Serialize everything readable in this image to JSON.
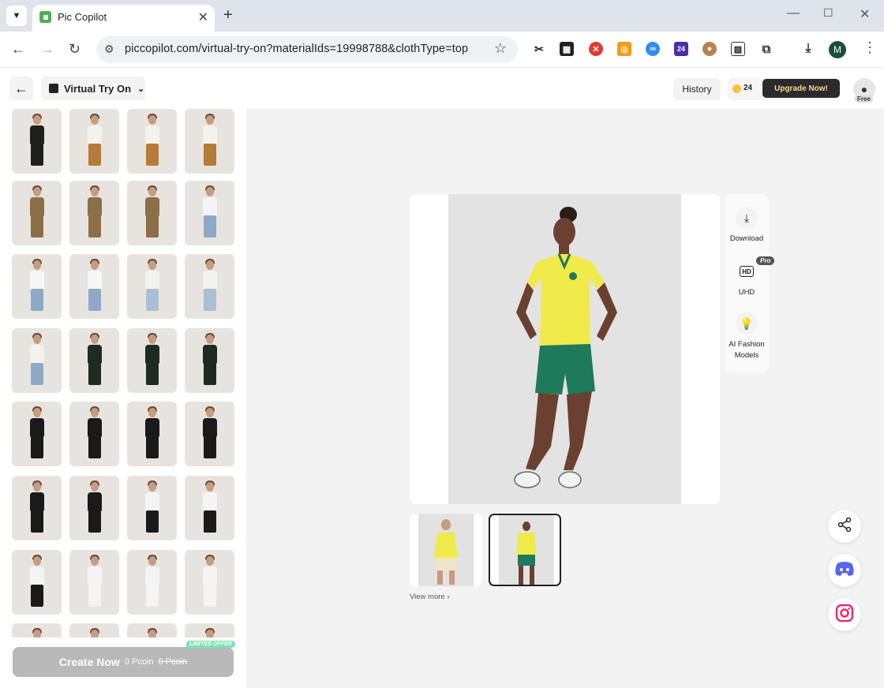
{
  "browser": {
    "tab_title": "Pic Copilot",
    "url": "piccopilot.com/virtual-try-on?materialIds=19998788&clothType=top",
    "profile_initial": "M",
    "extension_badge": "24"
  },
  "app": {
    "mode_label": "Virtual Try On",
    "history_label": "History",
    "coin_count": "24",
    "upgrade_label": "Upgrade Now!",
    "plan_badge": "Free"
  },
  "left_panel": {
    "thumbnails": [
      {
        "top": "#1f1f1f",
        "bottom": "#1f1f1f"
      },
      {
        "top": "#f4f2ee",
        "bottom": "#b67a3a"
      },
      {
        "top": "#f4f2ee",
        "bottom": "#b67a3a"
      },
      {
        "top": "#f4f2ee",
        "bottom": "#b67a3a"
      },
      {
        "top": "#8a6f47",
        "bottom": "#8a6f47"
      },
      {
        "top": "#8a6f47",
        "bottom": "#8a6f47"
      },
      {
        "top": "#8a6f47",
        "bottom": "#8a6f47"
      },
      {
        "top": "#f4f4f4",
        "bottom": "#8da9c6"
      },
      {
        "top": "#f7f7f7",
        "bottom": "#8da9c6"
      },
      {
        "top": "#f7f7f7",
        "bottom": "#8da9c6"
      },
      {
        "top": "#f4f2ee",
        "bottom": "#a9bfd4"
      },
      {
        "top": "#f4f2ee",
        "bottom": "#a9bfd4"
      },
      {
        "top": "#f4f2ee",
        "bottom": "#8da9c6"
      },
      {
        "top": "#1e2a24",
        "bottom": "#1e2a24"
      },
      {
        "top": "#1e2a24",
        "bottom": "#1e2a24"
      },
      {
        "top": "#1e2a24",
        "bottom": "#1e2a24"
      },
      {
        "top": "#1a1a1a",
        "bottom": "#1a1a1a"
      },
      {
        "top": "#1a1a1a",
        "bottom": "#1a1a1a"
      },
      {
        "top": "#1a1a1a",
        "bottom": "#1a1a1a"
      },
      {
        "top": "#1a1a1a",
        "bottom": "#1a1a1a"
      },
      {
        "top": "#1a1a1a",
        "bottom": "#1a1a1a"
      },
      {
        "top": "#1a1a1a",
        "bottom": "#1a1a1a"
      },
      {
        "top": "#f4f4f4",
        "bottom": "#1a1a1a"
      },
      {
        "top": "#f4f4f4",
        "bottom": "#1a1a1a"
      },
      {
        "top": "#f4f4f4",
        "bottom": "#1a1a1a"
      },
      {
        "top": "#f4f4f4",
        "bottom": "#f4f4f4"
      },
      {
        "top": "#f4f4f4",
        "bottom": "#f4f4f4"
      },
      {
        "top": "#f4f4f4",
        "bottom": "#f4f4f4"
      },
      {
        "top": "#e7e4e0",
        "bottom": "#e7e4e0"
      },
      {
        "top": "#e7e4e0",
        "bottom": "#e7e4e0"
      },
      {
        "top": "#e7e4e0",
        "bottom": "#e7e4e0"
      },
      {
        "top": "#e7e4e0",
        "bottom": "#e7e4e0"
      }
    ],
    "create": {
      "label": "Create Now",
      "price": "0 Pcoin",
      "old_price": "0 Pcoin",
      "offer_badge": "LIMITED OFFER"
    }
  },
  "canvas": {
    "actions": [
      {
        "icon": "download-icon",
        "label": "Download"
      },
      {
        "icon": "hd-icon",
        "label": "UHD"
      },
      {
        "icon": "bulb-icon",
        "label": "AI Fashion Models"
      }
    ],
    "pro_badge": "Pro",
    "view_more": "View more ›"
  },
  "colors": {
    "accent_dark": "#2b2b2b",
    "jersey_yellow": "#f0ea4a",
    "shorts_green": "#1e7a5a",
    "main_bg": "#f3f3f3"
  }
}
